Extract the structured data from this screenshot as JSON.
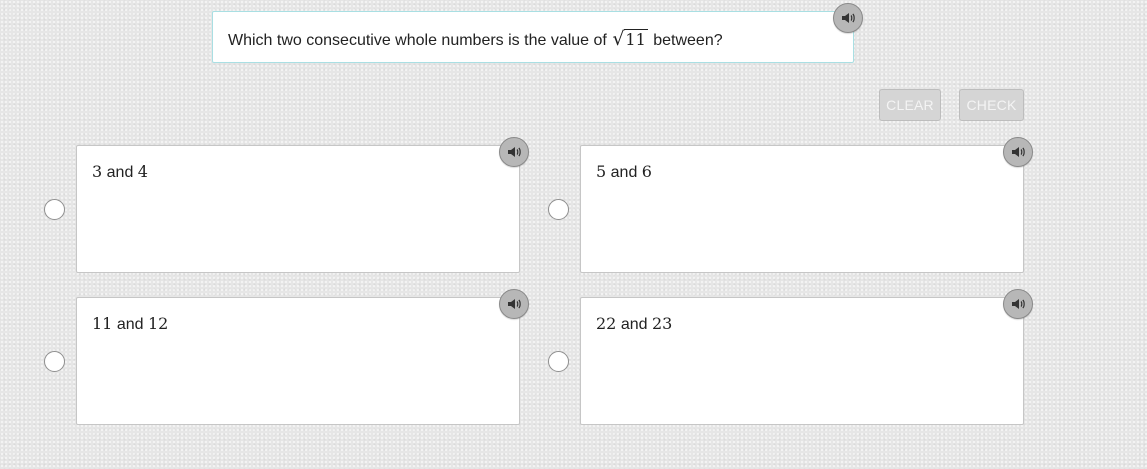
{
  "question": {
    "prefix": "Which two consecutive whole numbers is the value of",
    "radicand": "11",
    "suffix": "between?"
  },
  "buttons": {
    "clear_label": "CLEAR",
    "check_label": "CHECK"
  },
  "choices": [
    {
      "a": "3",
      "b": "4"
    },
    {
      "a": "5",
      "b": "6"
    },
    {
      "a": "11",
      "b": "12"
    },
    {
      "a": "22",
      "b": "23"
    }
  ],
  "connector": "and",
  "icons": {
    "audio": "speaker-icon"
  },
  "colors": {
    "question_border": "#a9dfe3",
    "button_bg": "#d5d5d5",
    "speaker_bg": "#b7b7b7"
  }
}
